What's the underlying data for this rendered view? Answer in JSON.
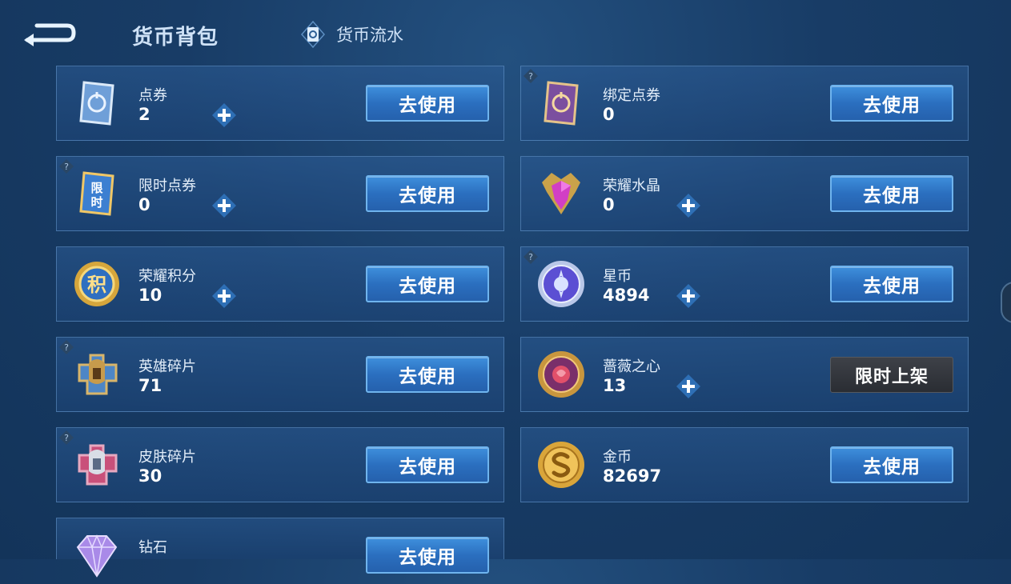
{
  "header": {
    "title": "货币背包",
    "flow_tab": "货币流水"
  },
  "buttons": {
    "use": "去使用",
    "limited": "限时上架"
  },
  "currencies": [
    {
      "name": "点券",
      "value": "2"
    },
    {
      "name": "绑定点券",
      "value": "0"
    },
    {
      "name": "限时点券",
      "value": "0"
    },
    {
      "name": "荣耀水晶",
      "value": "0"
    },
    {
      "name": "荣耀积分",
      "value": "10"
    },
    {
      "name": "星币",
      "value": "4894"
    },
    {
      "name": "英雄碎片",
      "value": "71"
    },
    {
      "name": "蔷薇之心",
      "value": "13"
    },
    {
      "name": "皮肤碎片",
      "value": "30"
    },
    {
      "name": "金币",
      "value": "82697"
    },
    {
      "name": "钻石",
      "value": ""
    }
  ],
  "icon_labels": {
    "limited_ticket": "限时",
    "honor_points": "积"
  }
}
